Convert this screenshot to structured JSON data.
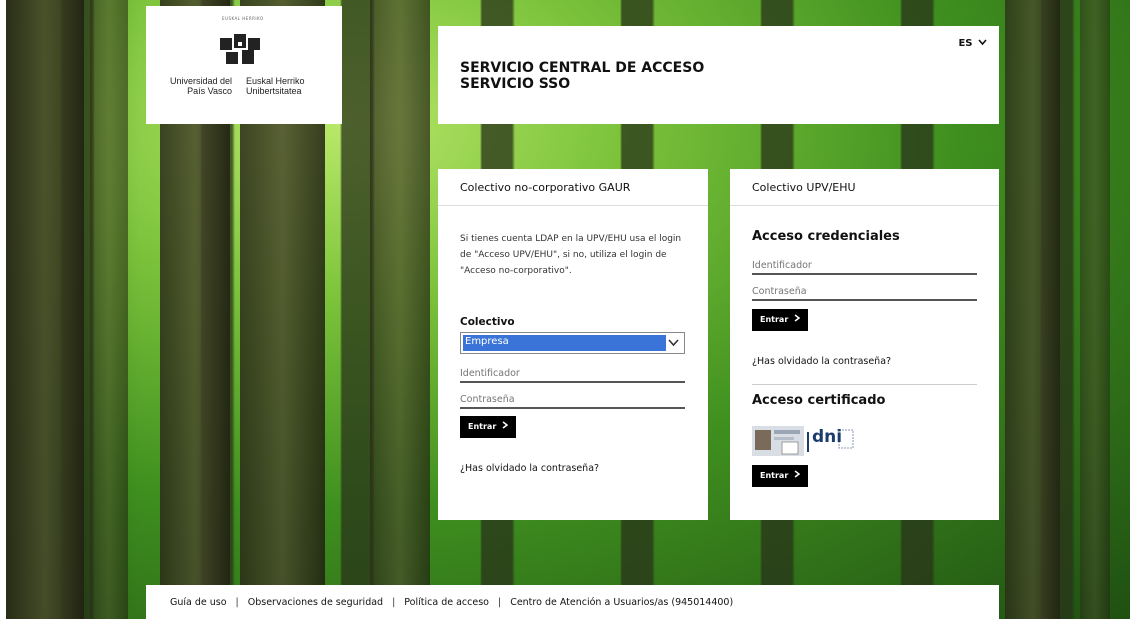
{
  "brand": {
    "small_text": "EUSKAL HERRIKO",
    "left_text": "Universidad del País Vasco",
    "right_text": "Euskal Herriko Unibertsitatea"
  },
  "header": {
    "title_line1": "SERVICIO CENTRAL DE ACCESO",
    "title_line2": "SERVICIO SSO",
    "language": "ES"
  },
  "left_card": {
    "title": "Colectivo no-corporativo GAUR",
    "info": "Si tienes cuenta LDAP en la UPV/EHU usa el login de \"Acceso UPV/EHU\", si no, utiliza el login de \"Acceso no-corporativo\".",
    "colectivo_label": "Colectivo",
    "colectivo_value": "Empresa",
    "id_placeholder": "Identificador",
    "pw_placeholder": "Contraseña",
    "submit_label": "Entrar",
    "forgot_link": "¿Has olvidado la contraseña?"
  },
  "right_card": {
    "title": "Colectivo UPV/EHU",
    "credentials_title": "Acceso credenciales",
    "id_placeholder": "Identificador",
    "pw_placeholder": "Contraseña",
    "submit_label": "Entrar",
    "forgot_link": "¿Has olvidado la contraseña?",
    "certificate_title": "Acceso certificado",
    "cert_logo_text": "dni",
    "cert_submit_label": "Entrar"
  },
  "footer": {
    "links": [
      "Guía de uso",
      "Observaciones de seguridad",
      "Política de acceso",
      "Centro de Atención a Usuarios/as  (945014400)"
    ]
  },
  "colors": {
    "button_bg": "#000000",
    "select_highlight": "#3a74d8",
    "background": "forest-green"
  },
  "icons": {
    "language_caret": "chevron-down-icon",
    "select_caret": "chevron-down-icon",
    "button_arrow": "chevron-right-icon",
    "certificate": "dni-card-icon"
  }
}
